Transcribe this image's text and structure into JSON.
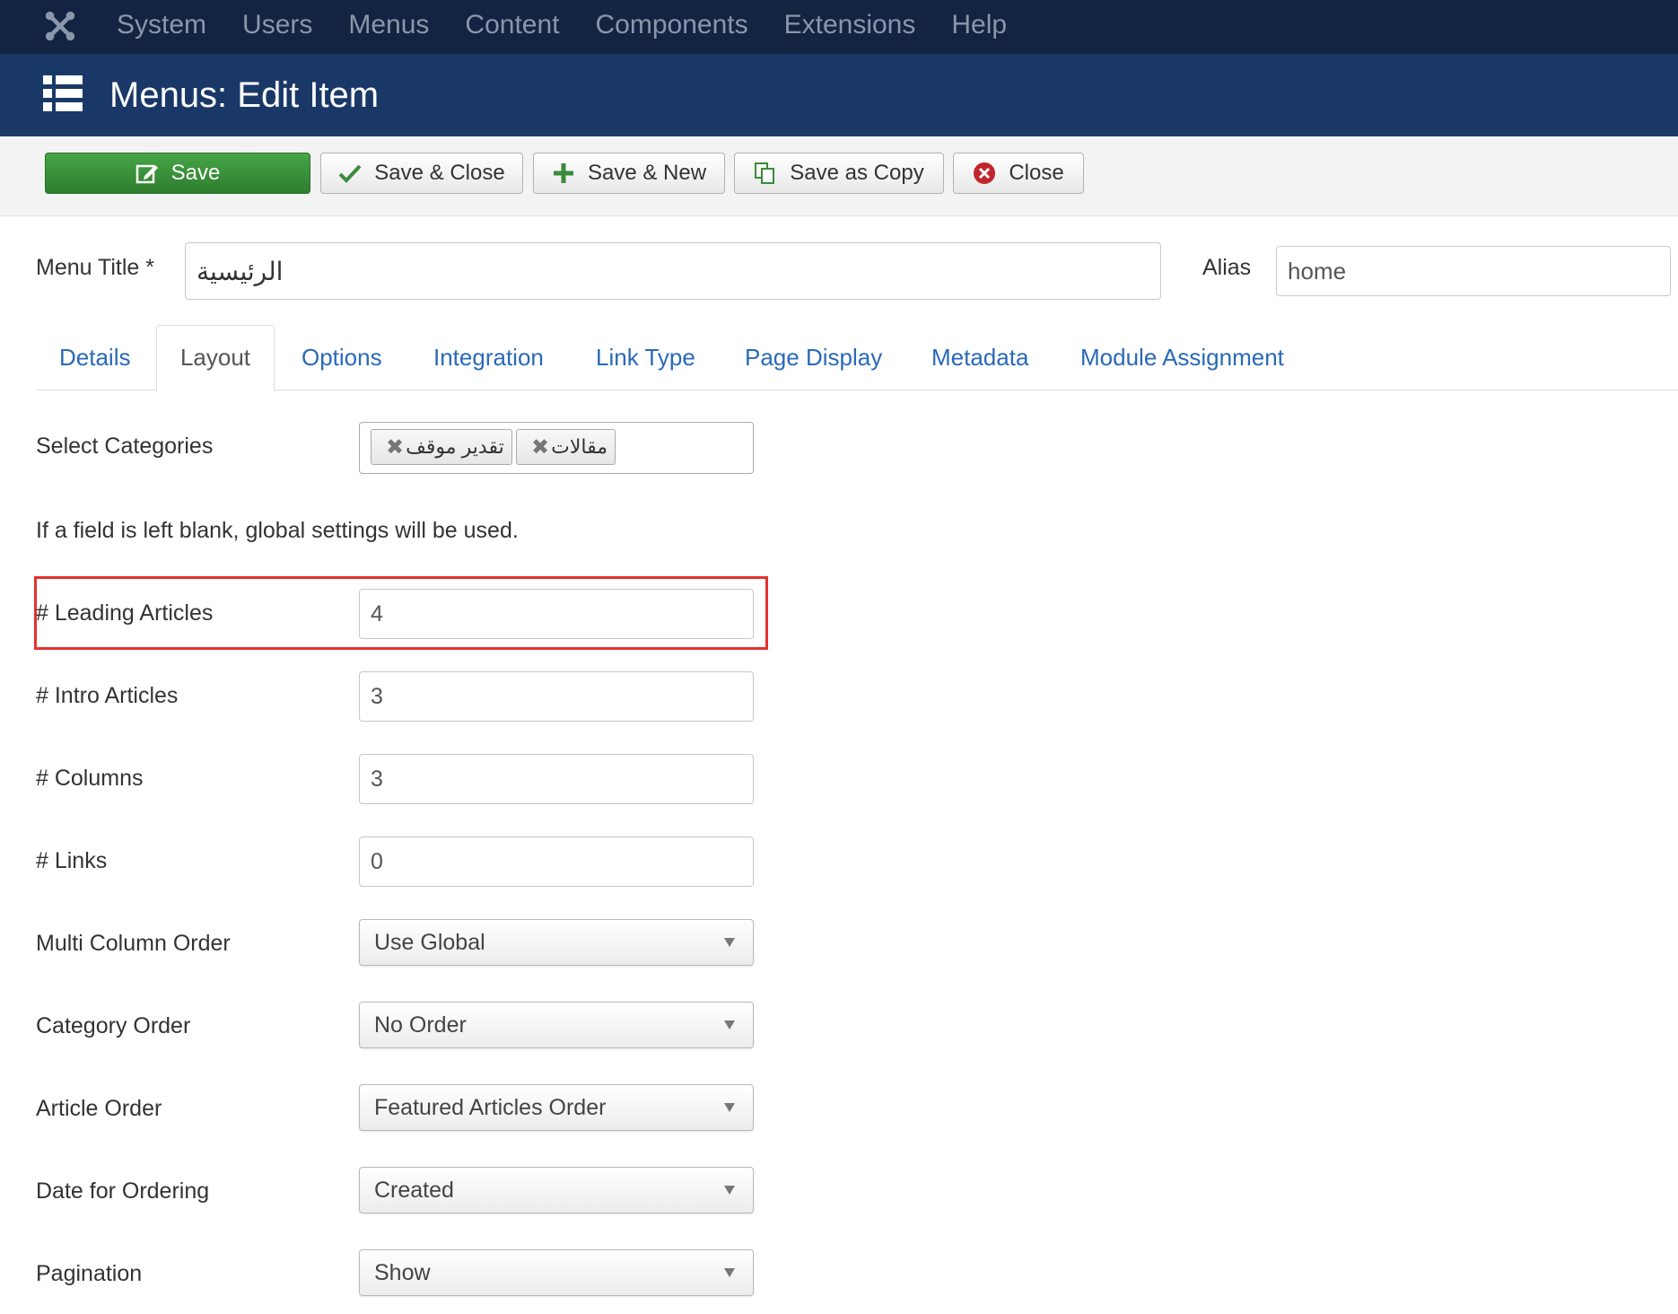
{
  "topnav": {
    "items": [
      "System",
      "Users",
      "Menus",
      "Content",
      "Components",
      "Extensions",
      "Help"
    ]
  },
  "header": {
    "title": "Menus: Edit Item"
  },
  "toolbar": {
    "save": "Save",
    "save_close": "Save & Close",
    "save_new": "Save & New",
    "save_copy": "Save as Copy",
    "close": "Close"
  },
  "form": {
    "menu_title_label": "Menu Title *",
    "menu_title_value": "الرئيسية",
    "alias_label": "Alias",
    "alias_value": "home"
  },
  "tabs": [
    "Details",
    "Layout",
    "Options",
    "Integration",
    "Link Type",
    "Page Display",
    "Metadata",
    "Module Assignment"
  ],
  "active_tab": "Layout",
  "layout": {
    "select_categories_label": "Select Categories",
    "categories": [
      "تقدير موقف",
      "مقالات"
    ],
    "note": "If a field is left blank, global settings will be used.",
    "leading_articles_label": "# Leading Articles",
    "leading_articles_value": "4",
    "intro_articles_label": "# Intro Articles",
    "intro_articles_value": "3",
    "columns_label": "# Columns",
    "columns_value": "3",
    "links_label": "# Links",
    "links_value": "0",
    "multi_column_order_label": "Multi Column Order",
    "multi_column_order_value": "Use Global",
    "category_order_label": "Category Order",
    "category_order_value": "No Order",
    "article_order_label": "Article Order",
    "article_order_value": "Featured Articles Order",
    "date_ordering_label": "Date for Ordering",
    "date_ordering_value": "Created",
    "pagination_label": "Pagination",
    "pagination_value": "Show"
  },
  "colors": {
    "topbar": "#122441",
    "header": "#1a3867",
    "save_button": "#3d963d",
    "tab_link": "#2a69b8",
    "highlight": "#e4312f"
  }
}
